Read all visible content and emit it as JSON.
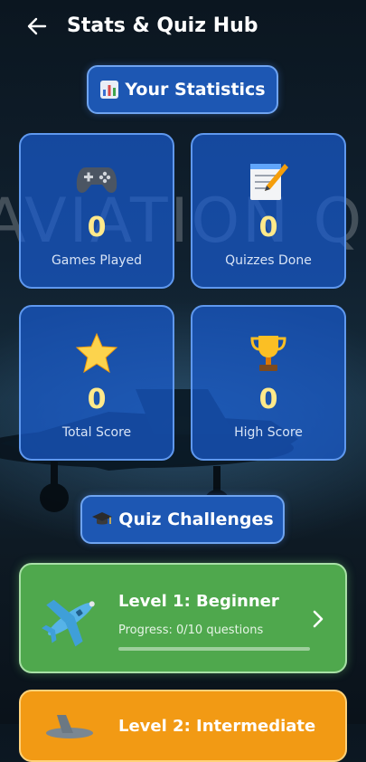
{
  "appbar": {
    "title": "Stats & Quiz Hub"
  },
  "background": {
    "watermark": "AVIATION QUIZ"
  },
  "stats_header": {
    "icon": "bar-chart-icon",
    "label": "Your Statistics"
  },
  "stats": [
    {
      "icon": "game-controller-icon",
      "value": "0",
      "label": "Games Played"
    },
    {
      "icon": "notepad-icon",
      "value": "0",
      "label": "Quizzes Done"
    },
    {
      "icon": "star-icon",
      "value": "0",
      "label": "Total Score"
    },
    {
      "icon": "trophy-icon",
      "value": "0",
      "label": "High Score"
    }
  ],
  "quiz_header": {
    "icon": "graduation-cap-icon",
    "label": "Quiz Challenges"
  },
  "levels": [
    {
      "title": "Level 1: Beginner",
      "progress_text": "Progress: 0/10 questions",
      "progress": 0.0,
      "color": "#4fa84d",
      "icon": "airplane-icon"
    },
    {
      "title": "Level 2: Intermediate",
      "color": "#f29a14",
      "icon": "airplane-icon"
    }
  ],
  "colors": {
    "stat_value": "#ffe98a",
    "card_blue": "#1d57b3"
  }
}
